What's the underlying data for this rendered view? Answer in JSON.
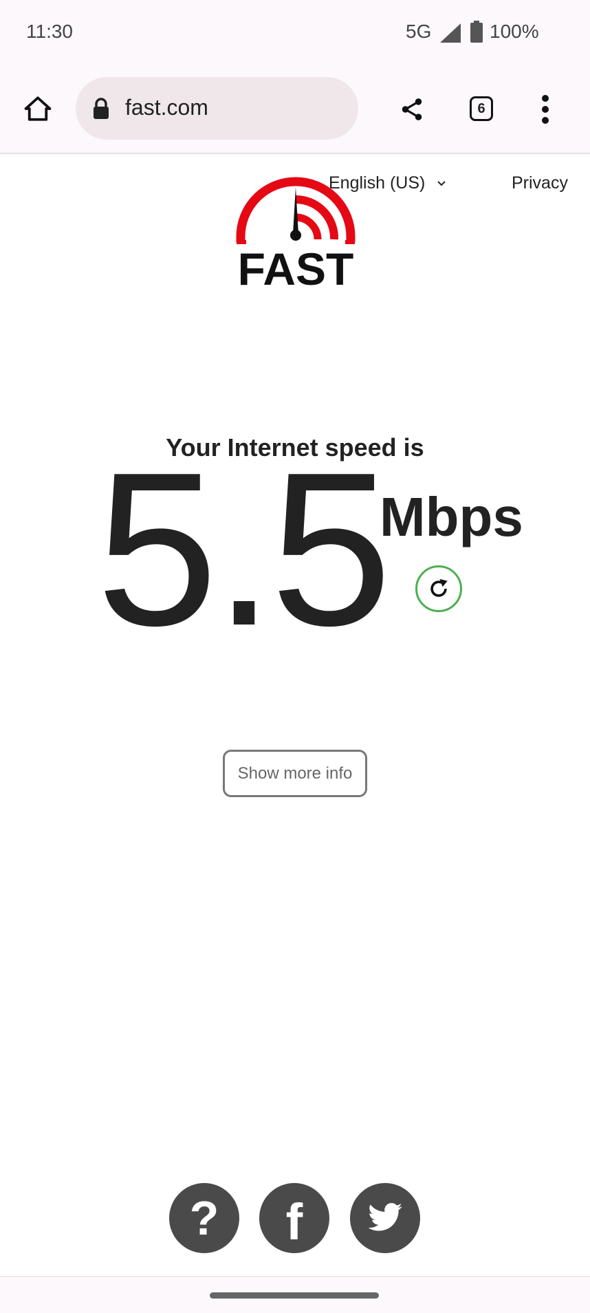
{
  "status_bar": {
    "time": "11:30",
    "network": "5G",
    "battery": "100%"
  },
  "browser": {
    "url": "fast.com",
    "tab_count": "6",
    "icons": [
      "home-icon",
      "lock-icon",
      "share-icon",
      "tabs-icon",
      "more-vert-icon"
    ]
  },
  "header": {
    "language": "English (US)",
    "privacy": "Privacy"
  },
  "logo": {
    "text": "FAST",
    "accent": "#e50914"
  },
  "result": {
    "label": "Your Internet speed is",
    "value": "5.5",
    "units": "Mbps",
    "refresh_color": "#4caf50"
  },
  "show_more_label": "Show more info",
  "footer": {
    "icons": [
      "help-icon",
      "facebook-icon",
      "twitter-icon"
    ]
  }
}
